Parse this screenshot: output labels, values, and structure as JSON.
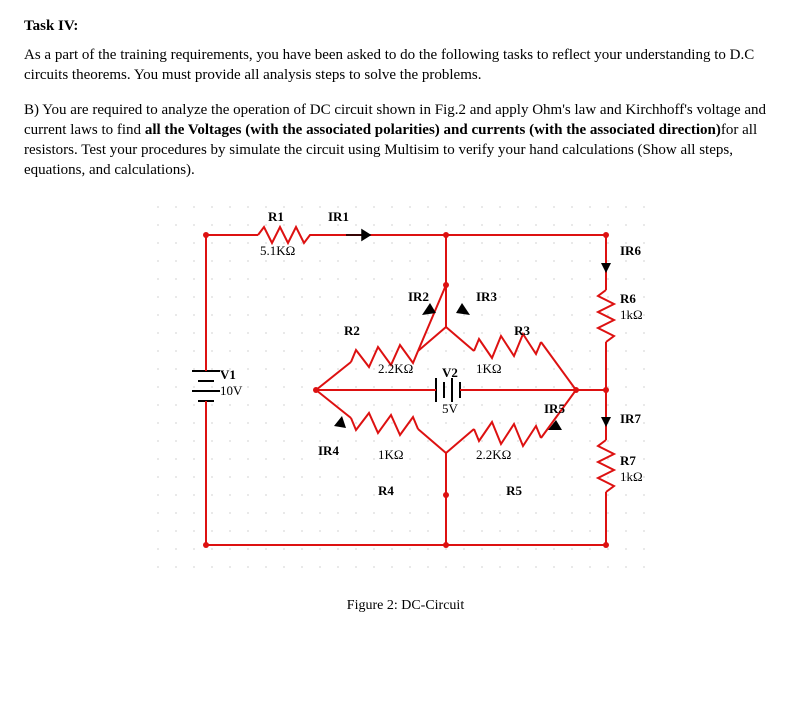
{
  "title": "Task IV:",
  "intro": "As a part of the training requirements, you have been asked to do the following tasks to reflect your understanding to D.C circuits theorems. You must provide all analysis steps to solve the problems.",
  "partB": {
    "prefix": "B)  You are required to analyze the operation of DC circuit shown in Fig.2 and apply Ohm's law and Kirchhoff's voltage and current laws to find ",
    "bold1": "all the Voltages (with the associated polarities) and currents (with the associated direction)",
    "suffix": "for all resistors. Test your procedures by simulate the circuit using Multisim to verify your hand calculations (Show  all steps, equations, and calculations)."
  },
  "figure": {
    "caption": "Figure 2: DC-Circuit",
    "source": {
      "V1": {
        "name": "V1",
        "value": "10V"
      },
      "V2": {
        "name": "V2",
        "value": "5V"
      }
    },
    "resistors": {
      "R1": {
        "name": "R1",
        "value": "5.1KΩ",
        "current": "IR1"
      },
      "R2": {
        "name": "R2",
        "value": "2.2KΩ",
        "current": "IR2"
      },
      "R3": {
        "name": "R3",
        "value": "1KΩ",
        "current": "IR3"
      },
      "R4": {
        "name": "R4",
        "value": "1KΩ",
        "current": "IR4"
      },
      "R5": {
        "name": "R5",
        "value": "2.2KΩ",
        "current": "IR5"
      },
      "R6": {
        "name": "R6",
        "value": "1kΩ",
        "current": "IR6"
      },
      "R7": {
        "name": "R7",
        "value": "1kΩ",
        "current": "IR7"
      }
    }
  }
}
